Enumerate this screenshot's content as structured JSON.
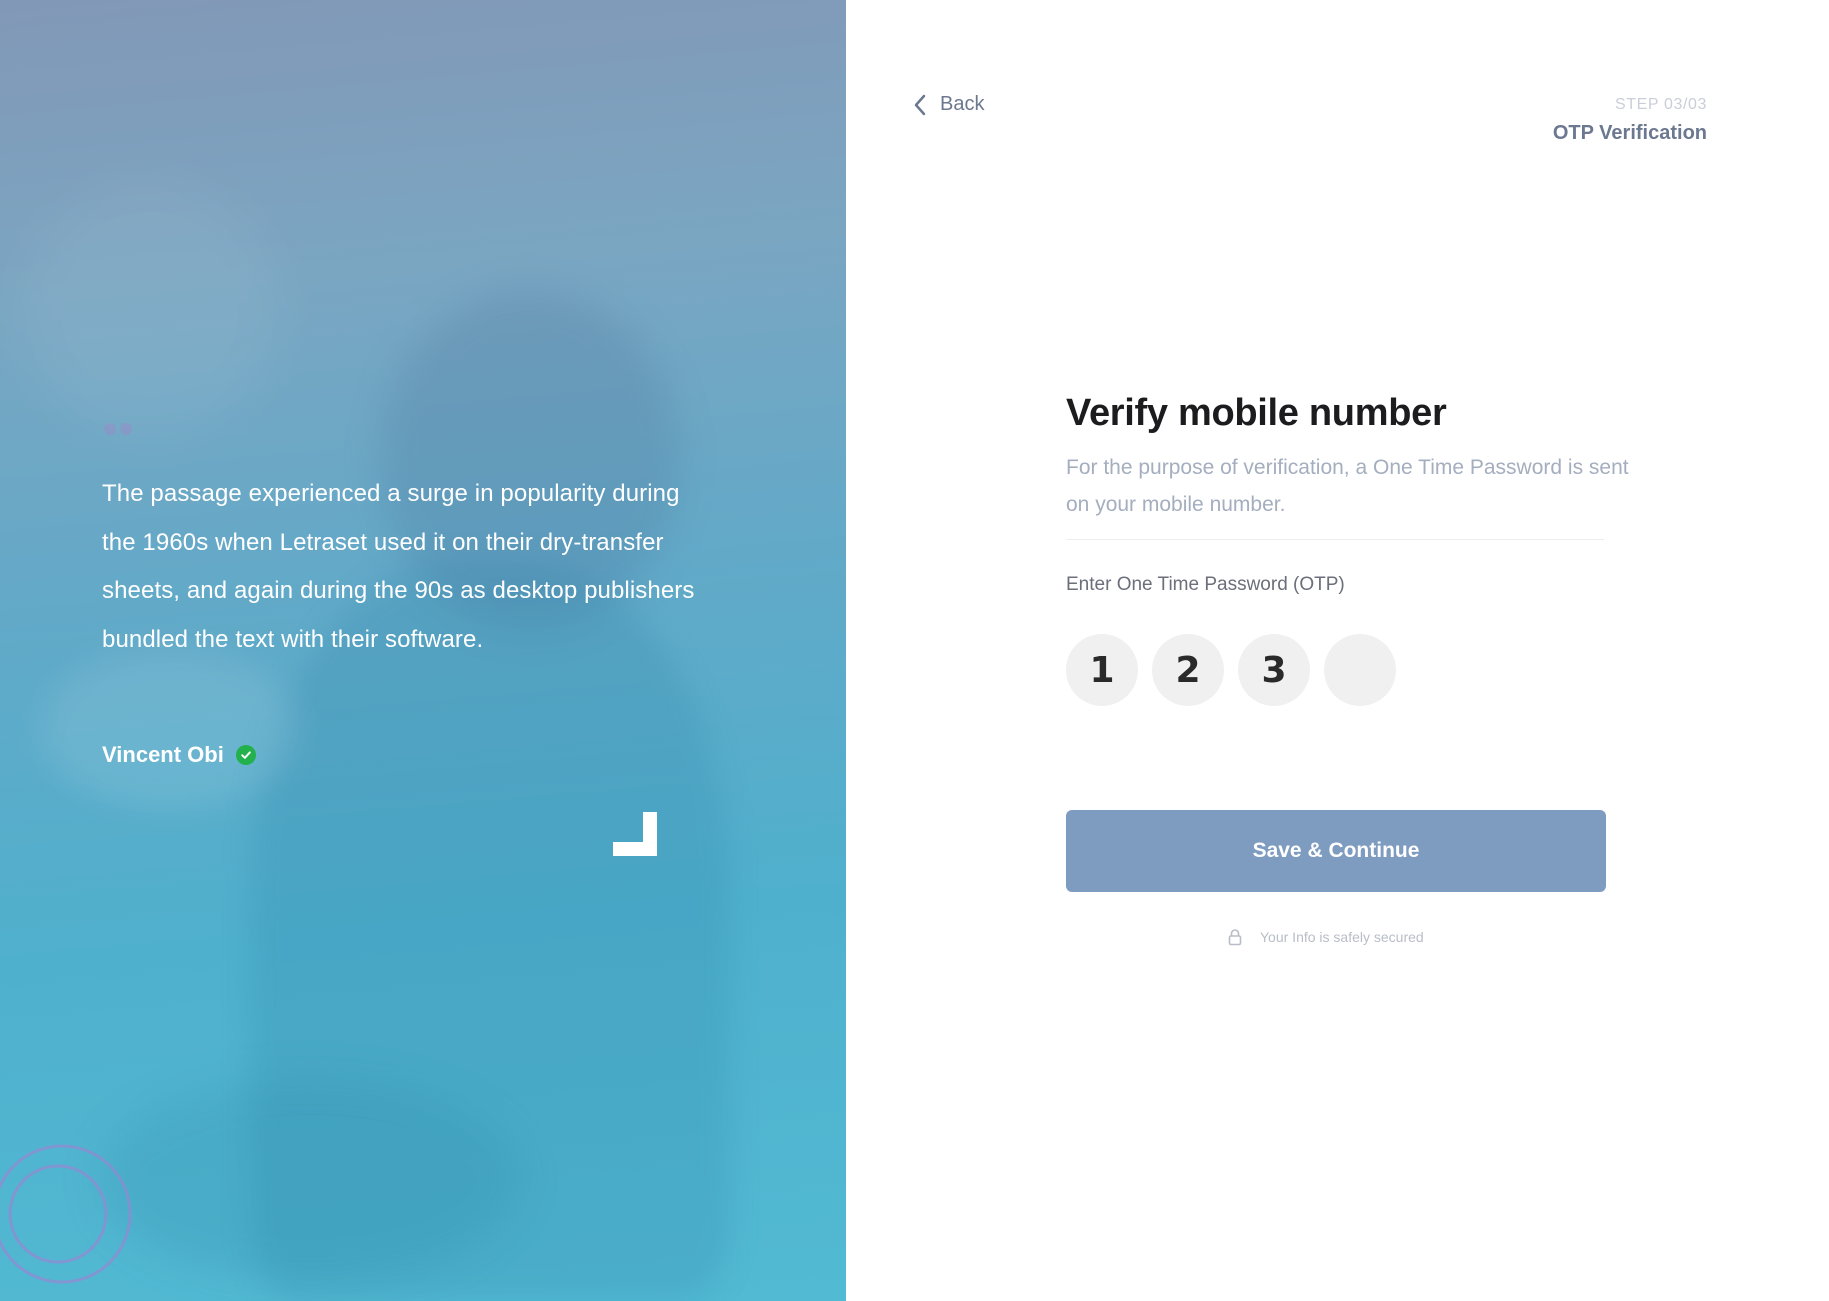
{
  "testimonial": {
    "quote": "The passage experienced a surge in popularity during the 1960s when Letraset used it on their dry-transfer sheets, and again during the 90s as desktop publishers bundled the text with their software.",
    "author": "Vincent Obi"
  },
  "header": {
    "back_label": "Back",
    "step_count": "STEP 03/03",
    "step_title": "OTP Verification"
  },
  "form": {
    "title": "Verify mobile number",
    "description": "For the purpose of verification, a One Time Password is sent on your mobile number.",
    "otp_label": "Enter One Time Password (OTP)",
    "otp_digits": [
      "1",
      "2",
      "3",
      ""
    ],
    "submit_label": "Save & Continue",
    "secure_note": "Your Info is safely secured"
  },
  "colors": {
    "primary_button": "#7e9bc0",
    "verified_badge": "#22b14c",
    "hero_gradient_top": "#8298b7",
    "hero_gradient_bottom": "#52bad3"
  },
  "icons": {
    "back": "chevron-left-icon",
    "verified": "check-circle-icon",
    "secure": "lock-icon"
  }
}
